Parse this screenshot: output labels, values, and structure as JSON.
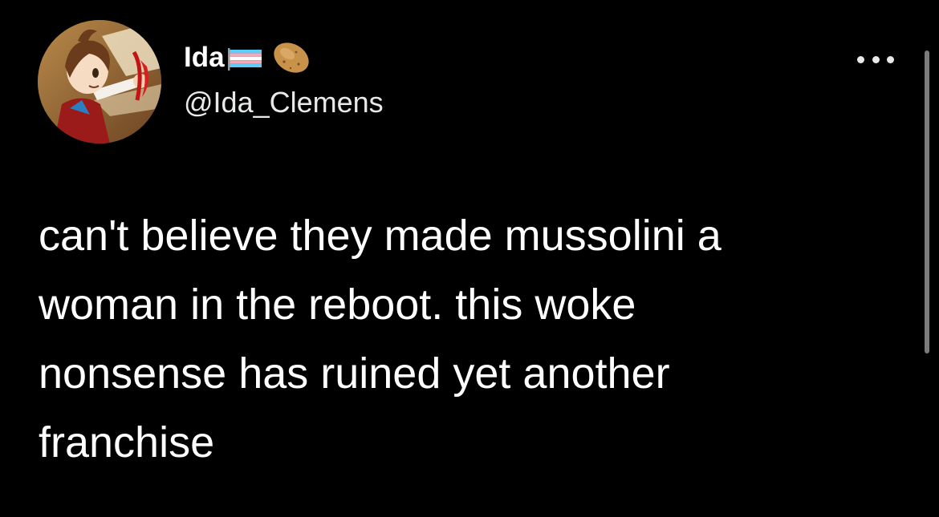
{
  "tweet": {
    "author": {
      "display_name": "Ida",
      "handle": "@Ida_Clemens",
      "badges": [
        "transgender-flag-emoji",
        "potato-emoji"
      ],
      "avatar": "anime-character-avatar"
    },
    "more_options_icon": "more-horizontal-icon",
    "text_lines": [
      "can't believe they made mussolini a",
      "woman in the reboot. this woke",
      "nonsense has ruined yet another",
      "franchise"
    ]
  },
  "colors": {
    "background": "#000000",
    "text": "#ffffff",
    "secondary_text": "#e7e9ea",
    "flag_blue": "#5bcefa",
    "flag_pink": "#f5a9b8",
    "flag_white": "#ffffff",
    "potato": "#c9924a"
  }
}
